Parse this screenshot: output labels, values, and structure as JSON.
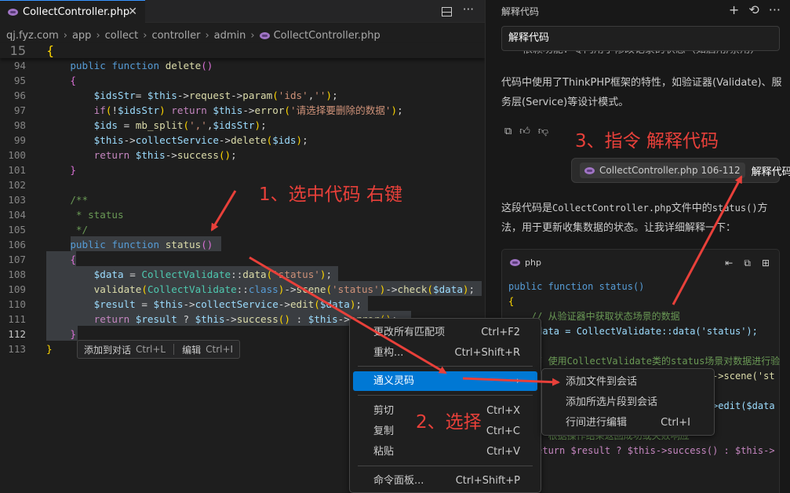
{
  "editor": {
    "tab": {
      "label": "CollectController.php"
    },
    "breadcrumb": [
      "qj.fyz.com",
      "app",
      "collect",
      "controller",
      "admin",
      "CollectController.php"
    ],
    "code_lines": [
      {
        "n": "94"
      },
      {
        "n": "95"
      },
      {
        "n": "96"
      },
      {
        "n": "97"
      },
      {
        "n": "98"
      },
      {
        "n": "99"
      },
      {
        "n": "100"
      },
      {
        "n": "101"
      },
      {
        "n": "102"
      },
      {
        "n": "103"
      },
      {
        "n": "104"
      },
      {
        "n": "105"
      },
      {
        "n": "106"
      },
      {
        "n": "107"
      },
      {
        "n": "108"
      },
      {
        "n": "109"
      },
      {
        "n": "110"
      },
      {
        "n": "111"
      },
      {
        "n": "112"
      },
      {
        "n": "113"
      }
    ],
    "sticky_line_number": "15",
    "inline_hint": {
      "add_label": "添加到对话",
      "add_shortcut": "Ctrl+L",
      "edit_label": "编辑",
      "edit_shortcut": "Ctrl+I"
    }
  },
  "context_menu": {
    "items": [
      {
        "label": "更改所有匹配项",
        "shortcut": "Ctrl+F2"
      },
      {
        "label": "重构...",
        "shortcut": "Ctrl+Shift+R"
      },
      {
        "label": "通义灵码",
        "shortcut": ""
      },
      {
        "label": "剪切",
        "shortcut": "Ctrl+X"
      },
      {
        "label": "复制",
        "shortcut": "Ctrl+C"
      },
      {
        "label": "粘贴",
        "shortcut": "Ctrl+V"
      },
      {
        "label": "命令面板...",
        "shortcut": "Ctrl+Shift+P"
      }
    ]
  },
  "submenu": {
    "items": [
      {
        "label": "添加文件到会话",
        "shortcut": ""
      },
      {
        "label": "添加所选片段到会话",
        "shortcut": ""
      },
      {
        "label": "行间进行编辑",
        "shortcut": "Ctrl+I"
      }
    ]
  },
  "chat": {
    "title": "解释代码",
    "input_value": "解释代码",
    "partial_text": "- 依赖功能：专门用于修改记录的状态（如启用/禁用）",
    "para1": "代码中使用了ThinkPHP框架的特性，如验证器(Validate)、服务层(Service)等设计模式。",
    "request_chip": "CollectController.php 106-112",
    "request_text": "解释代码",
    "answer_a": "这段代码是",
    "answer_code1": "CollectController.php",
    "answer_b": "文件中的",
    "answer_code2": "status()",
    "answer_c": "方法，用于更新收集数据的状态。让我详细解释一下：",
    "codeblock_lang": "php",
    "codeblock_lines": [
      "public function status()",
      "{",
      "    // 从验证器中获取状态场景的数据",
      "    $data = CollectValidate::data('status');",
      "",
      "    // 使用CollectValidate类的status场景对数据进行验",
      "    validate(CollectValidate::class)->scene('st",
      "",
      "    $result = $this->collectService->edit($data",
      "",
      "    // 根据操作结果返回成功或失败响应",
      "    return $result ? $this->success() : $this->"
    ]
  },
  "annotations": {
    "step1": "1、选中代码 右键",
    "step2": "2、选择",
    "step3": "3、指令 解释代码"
  },
  "colors": {
    "annotation": "#e8403a",
    "selection": "#264f78",
    "menu_highlight": "#0078d4"
  }
}
